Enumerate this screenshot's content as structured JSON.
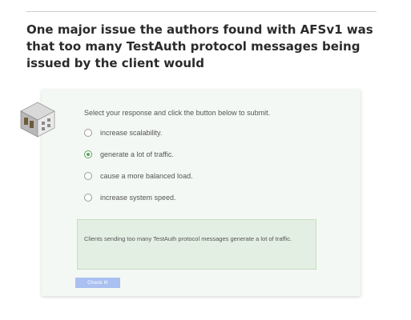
{
  "question": {
    "text": "One major issue the authors found with AFSv1 was that too many TestAuth protocol messages being issued by the client would"
  },
  "quiz": {
    "icon": "building-icon",
    "prompt": "Select your response and click the button below to submit.",
    "options": [
      {
        "label": "increase scalability.",
        "selected": false
      },
      {
        "label": "generate a lot of traffic.",
        "selected": true
      },
      {
        "label": "cause a more balanced load.",
        "selected": false
      },
      {
        "label": "increase system speed.",
        "selected": false
      }
    ],
    "feedback": "Clients sending too many TestAuth protocol messages generate a lot of traffic.",
    "submit_label": "Check It!"
  },
  "colors": {
    "accent": "#5fa35f",
    "button": "#a9c0f0",
    "card_bg": "#f4f8f4",
    "feedback_bg": "#e3efe2"
  }
}
